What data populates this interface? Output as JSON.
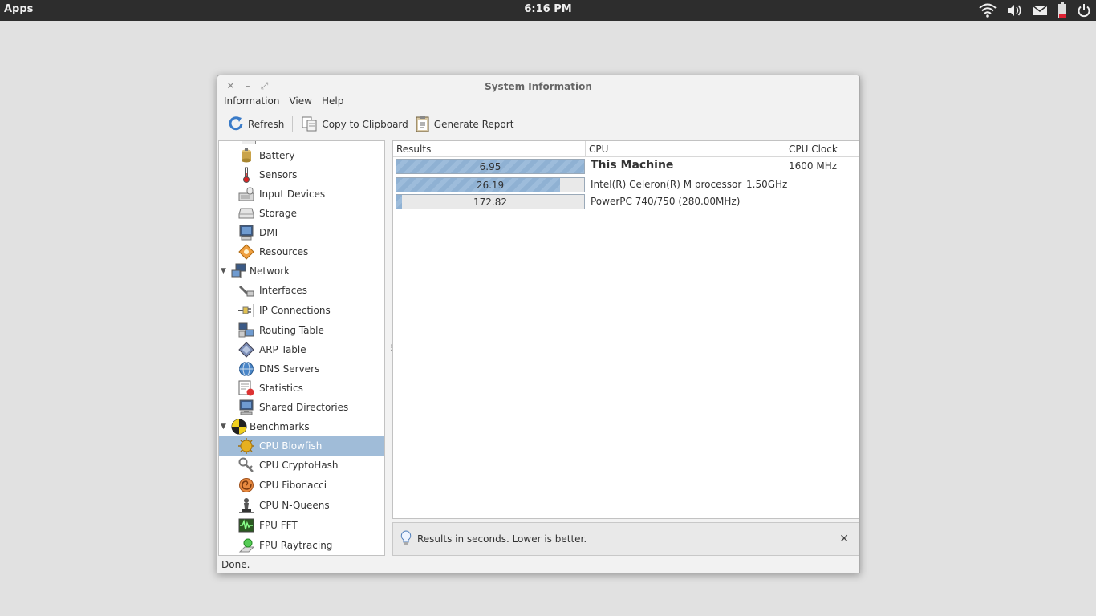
{
  "panel": {
    "apps_label": "Apps",
    "clock": "6:16 PM",
    "tray_icons": [
      "wifi-icon",
      "volume-icon",
      "mail-icon",
      "battery-icon",
      "power-icon"
    ]
  },
  "window": {
    "title": "System Information",
    "menu": [
      "Information",
      "View",
      "Help"
    ],
    "toolbar": {
      "refresh": "Refresh",
      "copy": "Copy to Clipboard",
      "report": "Generate Report"
    },
    "status": "Done."
  },
  "tree": {
    "items": [
      {
        "label": "Battery",
        "icon": "battery-device-icon",
        "level": "child"
      },
      {
        "label": "Sensors",
        "icon": "thermometer-icon",
        "level": "child"
      },
      {
        "label": "Input Devices",
        "icon": "input-devices-icon",
        "level": "child"
      },
      {
        "label": "Storage",
        "icon": "storage-icon",
        "level": "child"
      },
      {
        "label": "DMI",
        "icon": "dmi-icon",
        "level": "child"
      },
      {
        "label": "Resources",
        "icon": "resources-icon",
        "level": "child"
      },
      {
        "label": "Network",
        "icon": "network-icon",
        "level": "parent"
      },
      {
        "label": "Interfaces",
        "icon": "interfaces-icon",
        "level": "child"
      },
      {
        "label": "IP Connections",
        "icon": "ip-connections-icon",
        "level": "child"
      },
      {
        "label": "Routing Table",
        "icon": "routing-table-icon",
        "level": "child"
      },
      {
        "label": "ARP Table",
        "icon": "arp-table-icon",
        "level": "child"
      },
      {
        "label": "DNS Servers",
        "icon": "dns-servers-icon",
        "level": "child"
      },
      {
        "label": "Statistics",
        "icon": "statistics-icon",
        "level": "child"
      },
      {
        "label": "Shared Directories",
        "icon": "shared-directories-icon",
        "level": "child"
      },
      {
        "label": "Benchmarks",
        "icon": "benchmarks-icon",
        "level": "parent"
      },
      {
        "label": "CPU Blowfish",
        "icon": "cpu-blowfish-icon",
        "level": "child",
        "selected": true
      },
      {
        "label": "CPU CryptoHash",
        "icon": "cpu-cryptohash-icon",
        "level": "child"
      },
      {
        "label": "CPU Fibonacci",
        "icon": "cpu-fibonacci-icon",
        "level": "child"
      },
      {
        "label": "CPU N-Queens",
        "icon": "cpu-nqueens-icon",
        "level": "child"
      },
      {
        "label": "FPU FFT",
        "icon": "fpu-fft-icon",
        "level": "child"
      },
      {
        "label": "FPU Raytracing",
        "icon": "fpu-raytracing-icon",
        "level": "child"
      }
    ]
  },
  "results": {
    "headers": {
      "results": "Results",
      "cpu": "CPU",
      "clock": "CPU Clock"
    },
    "rows": [
      {
        "value": "6.95",
        "fill": 1.0,
        "cpu": "This Machine",
        "cpu_bold": true,
        "ghz": "",
        "clock": "1600 MHz"
      },
      {
        "value": "26.19",
        "fill": 0.87,
        "cpu": "Intel(R) Celeron(R) M processor",
        "cpu_bold": false,
        "ghz": "1.50GHz",
        "clock": ""
      },
      {
        "value": "172.82",
        "fill": 0.03,
        "cpu": "PowerPC 740/750 (280.00MHz)",
        "cpu_bold": false,
        "ghz": "",
        "clock": ""
      }
    ]
  },
  "infobar": {
    "message": "Results in seconds. Lower is better."
  },
  "colors": {
    "selection": "#a0bcd8",
    "bar_fill": "#8fb1d3",
    "panel_bg": "#2d2d2d"
  }
}
